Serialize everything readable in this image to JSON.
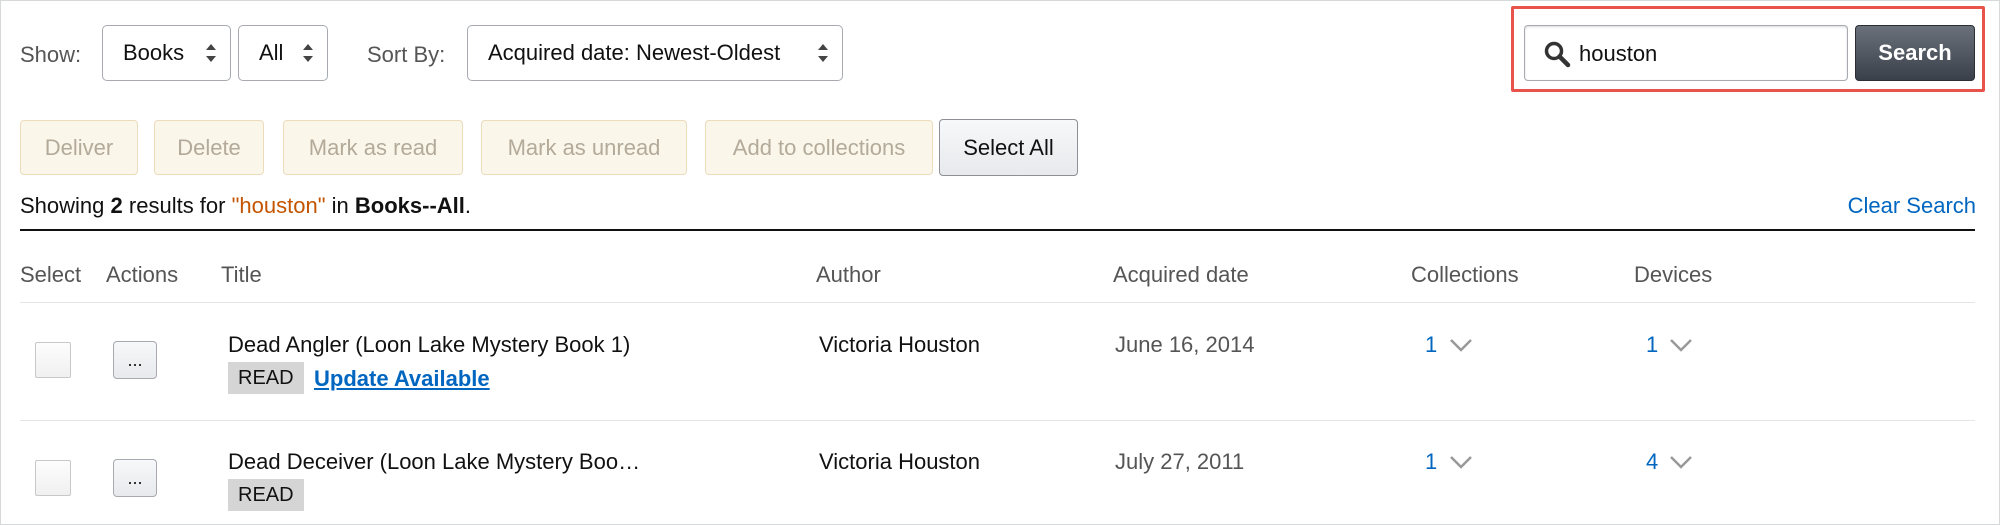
{
  "filters": {
    "show_label": "Show:",
    "show_value": "Books",
    "subset_value": "All",
    "sort_label": "Sort By:",
    "sort_value": "Acquired date: Newest-Oldest"
  },
  "search": {
    "value": "houston",
    "button_label": "Search"
  },
  "bulk_actions": {
    "deliver": "Deliver",
    "delete": "Delete",
    "mark_read": "Mark as read",
    "mark_unread": "Mark as unread",
    "add_collections": "Add to collections",
    "select_all": "Select All"
  },
  "summary": {
    "prefix": "Showing",
    "count": "2",
    "mid": "results for",
    "query": "\"houston\"",
    "in": "in",
    "scope": "Books--All",
    "end": ".",
    "clear_label": "Clear Search"
  },
  "table": {
    "headers": [
      "Select",
      "Actions",
      "Title",
      "Author",
      "Acquired date",
      "Collections",
      "Devices"
    ],
    "rows": [
      {
        "actions_label": "...",
        "title": "Dead Angler (Loon Lake Mystery Book 1)",
        "status": "READ",
        "update_label": "Update Available",
        "author": "Victoria Houston",
        "acquired": "June 16, 2014",
        "collections": "1",
        "devices": "1"
      },
      {
        "actions_label": "...",
        "title": "Dead Deceiver (Loon Lake Mystery Boo…",
        "status": "READ",
        "author": "Victoria Houston",
        "acquired": "July 27, 2011",
        "collections": "1",
        "devices": "4"
      }
    ]
  },
  "colors": {
    "accent_link": "#0066c0",
    "query_highlight": "#c45500",
    "search_highlight_border": "#e8534b"
  }
}
